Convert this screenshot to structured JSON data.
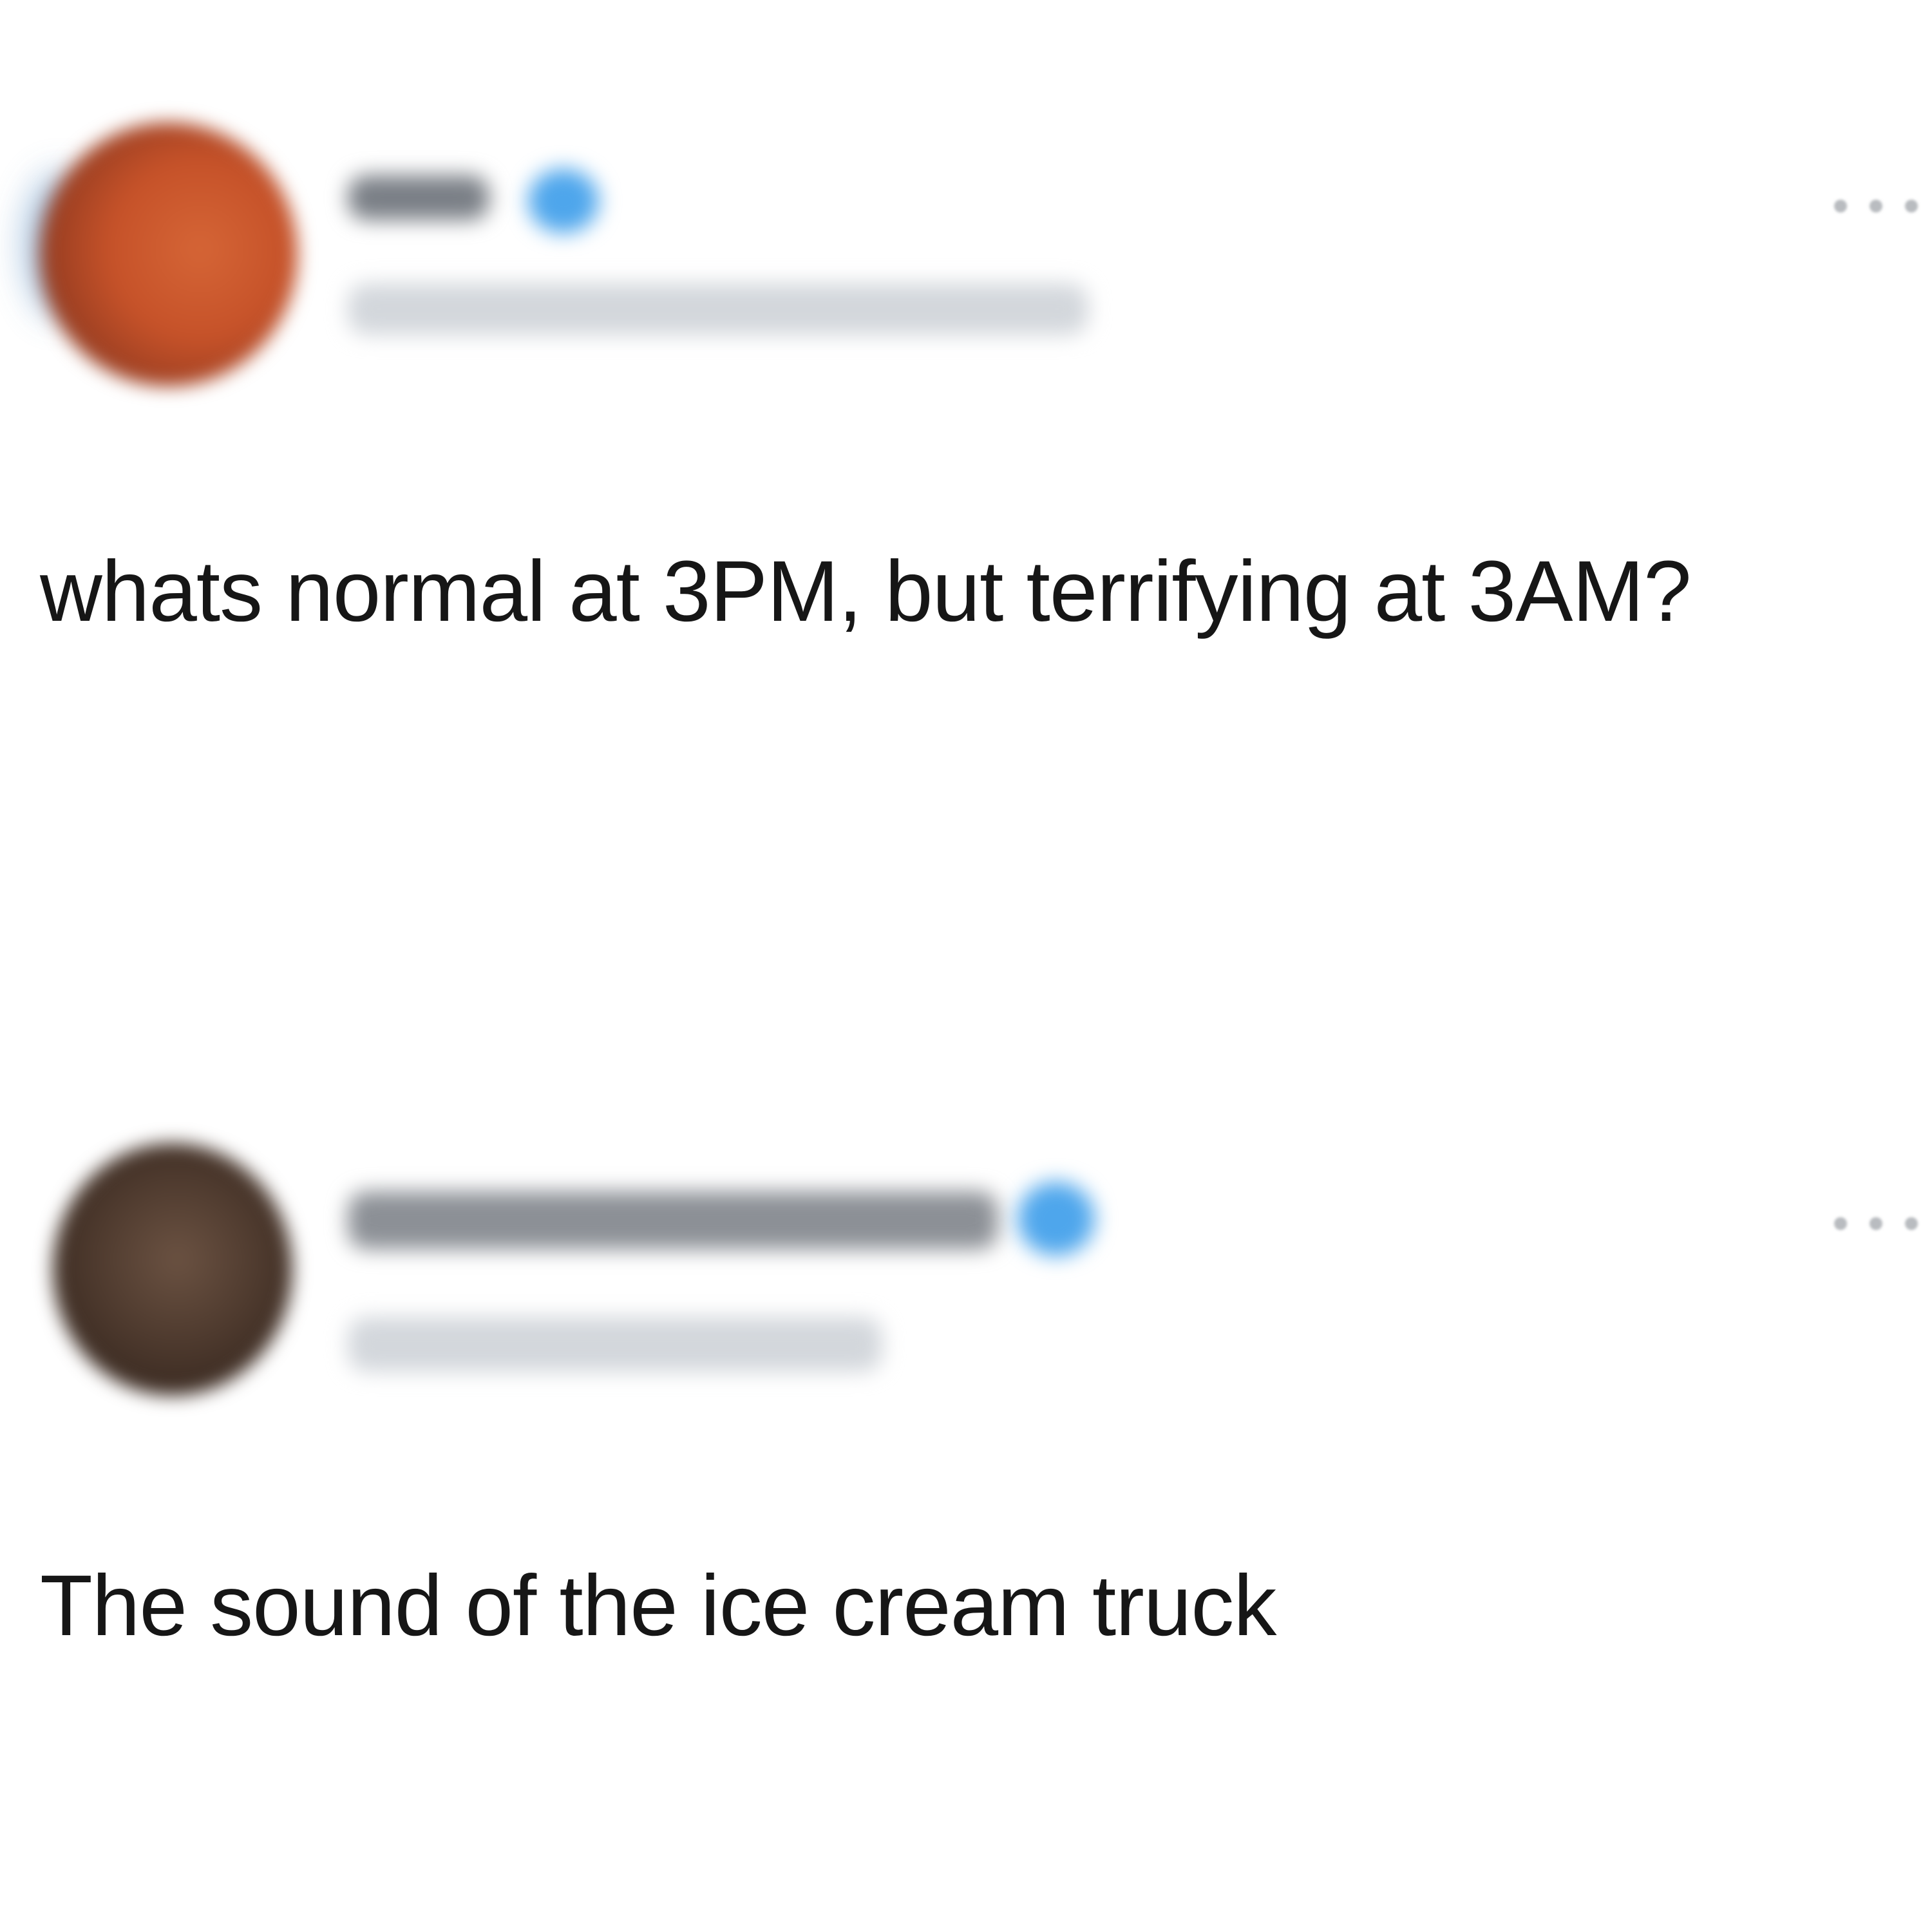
{
  "posts": [
    {
      "author_display_name": "",
      "author_handle": "",
      "verified": true,
      "avatar_colors": [
        "#c65229",
        "#8fb3d6"
      ],
      "more_icon": "more-horizontal-icon",
      "text": "whats normal at 3PM, but terrifying at 3AM?"
    },
    {
      "author_display_name": "",
      "author_handle": "",
      "verified": true,
      "avatar_colors": [
        "#4e3a2e"
      ],
      "more_icon": "more-horizontal-icon",
      "text": "The sound of the ice cream truck"
    }
  ],
  "colors": {
    "background": "#ffffff",
    "text": "#161616",
    "verified_badge": "#4ea6ec",
    "placeholder_blur": "#d3d7dc"
  }
}
